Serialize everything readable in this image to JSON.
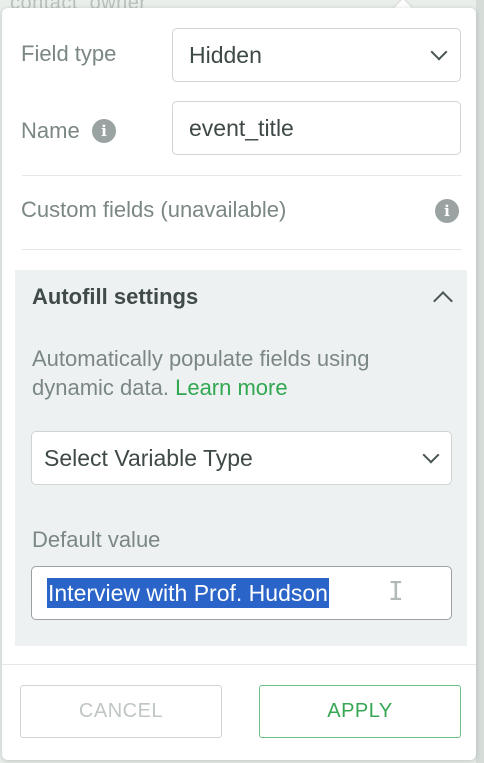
{
  "backdrop": {
    "text": "contact_owner"
  },
  "field_type": {
    "label": "Field type",
    "selected": "Hidden"
  },
  "name": {
    "label": "Name",
    "value": "event_title"
  },
  "custom_fields": {
    "label": "Custom fields (unavailable)"
  },
  "autofill": {
    "title": "Autofill settings",
    "description": "Automatically populate fields using dynamic data.",
    "learn_more": "Learn more",
    "variable_select": "Select Variable Type",
    "default_label": "Default value",
    "default_value": "Interview with Prof. Hudson"
  },
  "footer": {
    "cancel_label": "CANCEL",
    "apply_label": "APPLY"
  },
  "colors": {
    "accent_green": "#35a653",
    "selection_blue": "#2a64c8"
  },
  "icons": {
    "info": "info-icon",
    "chevron_down": "chevron-down-icon",
    "chevron_up": "chevron-up-icon",
    "text_cursor": "text-cursor-icon"
  }
}
